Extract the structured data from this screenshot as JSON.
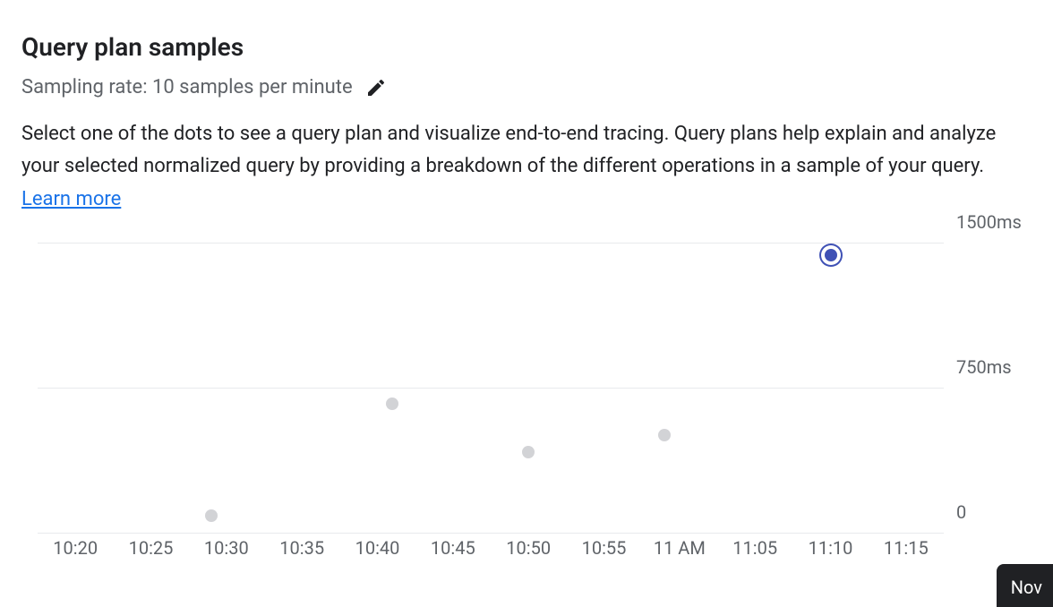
{
  "header": {
    "title": "Query plan samples",
    "subtitle": "Sampling rate: 10 samples per minute",
    "description": "Select one of the dots to see a query plan and visualize end-to-end tracing. Query plans help explain and analyze your selected normalized query by providing a breakdown of the different operations in a sample of your query.",
    "learn_more": "Learn more"
  },
  "chart_data": {
    "type": "scatter",
    "xlabel": "",
    "ylabel": "",
    "ylim": [
      0,
      1500
    ],
    "y_ticks": [
      {
        "value": 0,
        "label": "0"
      },
      {
        "value": 750,
        "label": "750ms"
      },
      {
        "value": 1500,
        "label": "1500ms"
      }
    ],
    "x_ticks": [
      "10:20",
      "10:25",
      "10:30",
      "10:35",
      "10:40",
      "10:45",
      "10:50",
      "10:55",
      "11 AM",
      "11:05",
      "11:10",
      "11:15"
    ],
    "series": [
      {
        "name": "samples",
        "points": [
          {
            "x": "10:29",
            "y": 90,
            "selected": false
          },
          {
            "x": "10:41",
            "y": 670,
            "selected": false
          },
          {
            "x": "10:50",
            "y": 420,
            "selected": false
          },
          {
            "x": "10:59",
            "y": 510,
            "selected": false
          },
          {
            "x": "11:10",
            "y": 1440,
            "selected": true
          }
        ]
      }
    ]
  },
  "toast": {
    "text": "Nov"
  }
}
